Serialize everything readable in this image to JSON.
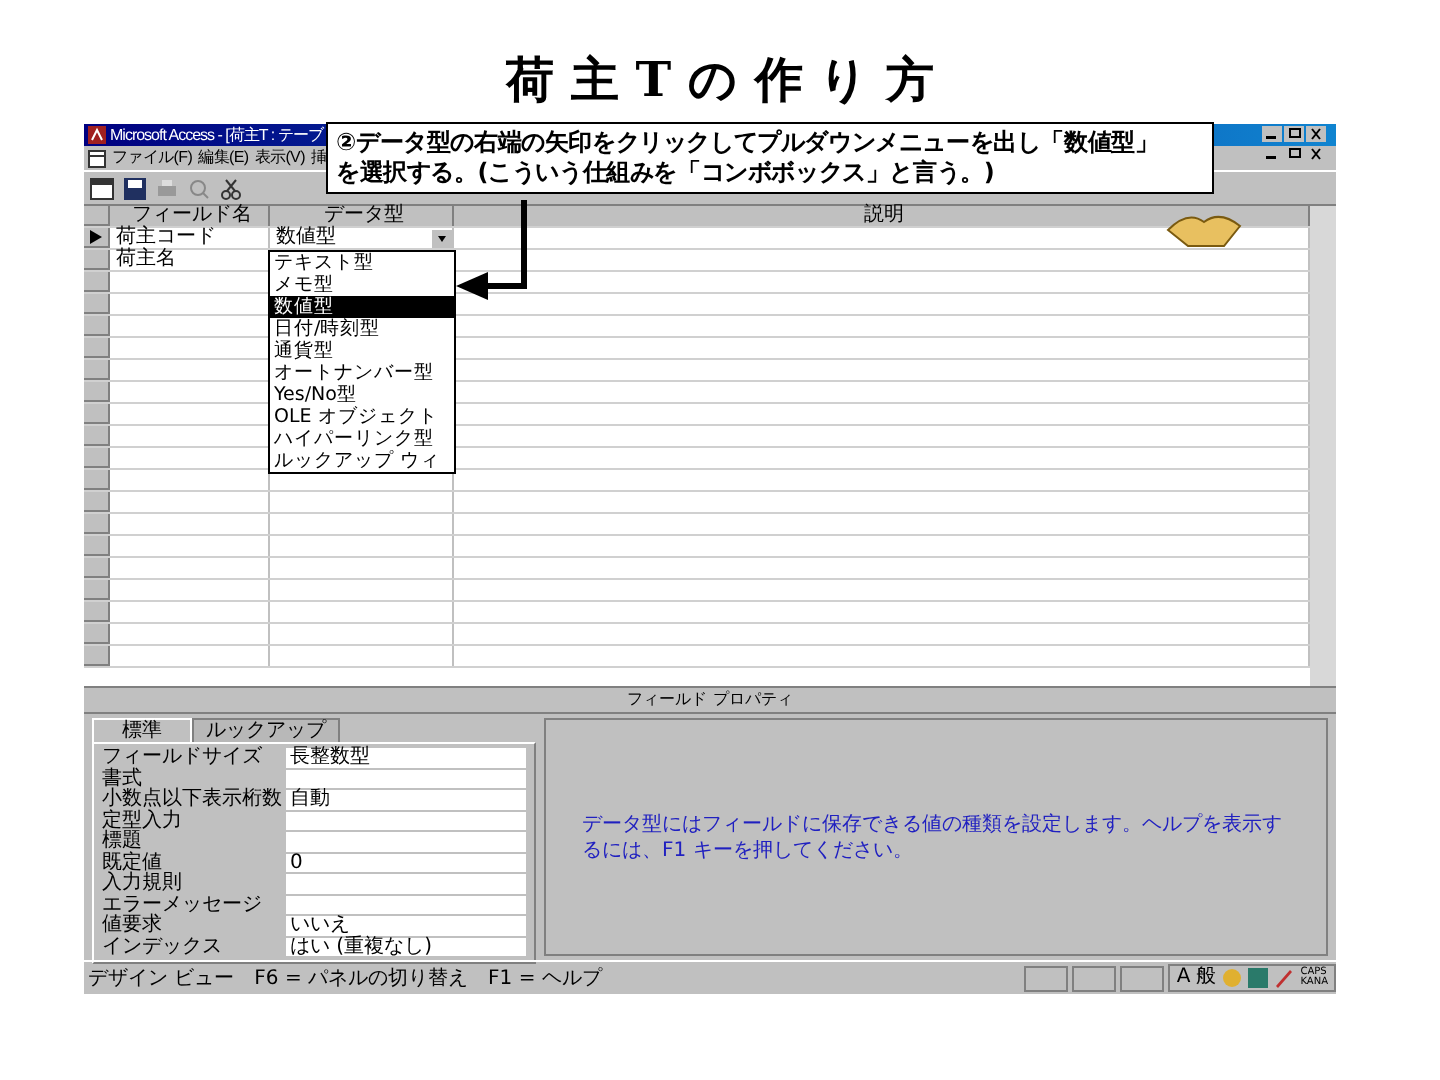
{
  "slide_title": "荷 主 T の 作 り 方",
  "window": {
    "title": "Microsoft Access - [荷主T : テーブ",
    "menu": [
      "ファイル(F)",
      "編集(E)",
      "表示(V)",
      "挿"
    ]
  },
  "callout": {
    "lines": [
      "②データ型の右端の矢印をクリックしてプルダウンメニューを出し「数値型」",
      "を選択する。(こういう仕組みを「コンボボックス」と言う。)"
    ]
  },
  "grid": {
    "columns": [
      "フィールド名",
      "データ型",
      "説明"
    ],
    "rows": [
      {
        "field_name": "荷主コード",
        "data_type": "数値型",
        "current": true
      },
      {
        "field_name": "荷主名",
        "current": false
      }
    ]
  },
  "dropdown": {
    "options": [
      {
        "label": "テキスト型",
        "selected": false
      },
      {
        "label": "メモ型",
        "selected": false
      },
      {
        "label": "数値型",
        "selected": true
      },
      {
        "label": "日付/時刻型",
        "selected": false
      },
      {
        "label": "通貨型",
        "selected": false
      },
      {
        "label": "オートナンバー型",
        "selected": false
      },
      {
        "label": "Yes/No型",
        "selected": false
      },
      {
        "label": "OLE オブジェクト",
        "selected": false
      },
      {
        "label": "ハイパーリンク型",
        "selected": false
      },
      {
        "label": "ルックアップ ウィ",
        "selected": false
      }
    ]
  },
  "properties_label": "フィールド プロパティ",
  "property_tabs": [
    {
      "label": "標準",
      "selected": true
    },
    {
      "label": "ルックアップ",
      "selected": false
    }
  ],
  "properties": [
    {
      "name": "フィールドサイズ",
      "value": "長整数型"
    },
    {
      "name": "書式"
    },
    {
      "name": "小数点以下表示桁数",
      "value": "自動"
    },
    {
      "name": "定型入力"
    },
    {
      "name": "標題"
    },
    {
      "name": "既定値",
      "value": "0"
    },
    {
      "name": "入力規則"
    },
    {
      "name": "エラーメッセージ"
    },
    {
      "name": "値要求",
      "value": "いいえ"
    },
    {
      "name": "インデックス",
      "value": "はい (重複なし)"
    }
  ],
  "help_text": "データ型にはフィールドに保存できる値の種類を設定します。ヘルプを表示するには、F1 キーを押してください。",
  "status_bar": {
    "text": "デザイン ビュー　F6 = パネルの切り替え　F1 = ヘルプ",
    "tray": [
      "A",
      "般"
    ],
    "indicator": [
      "CAPS",
      "KANA"
    ]
  }
}
